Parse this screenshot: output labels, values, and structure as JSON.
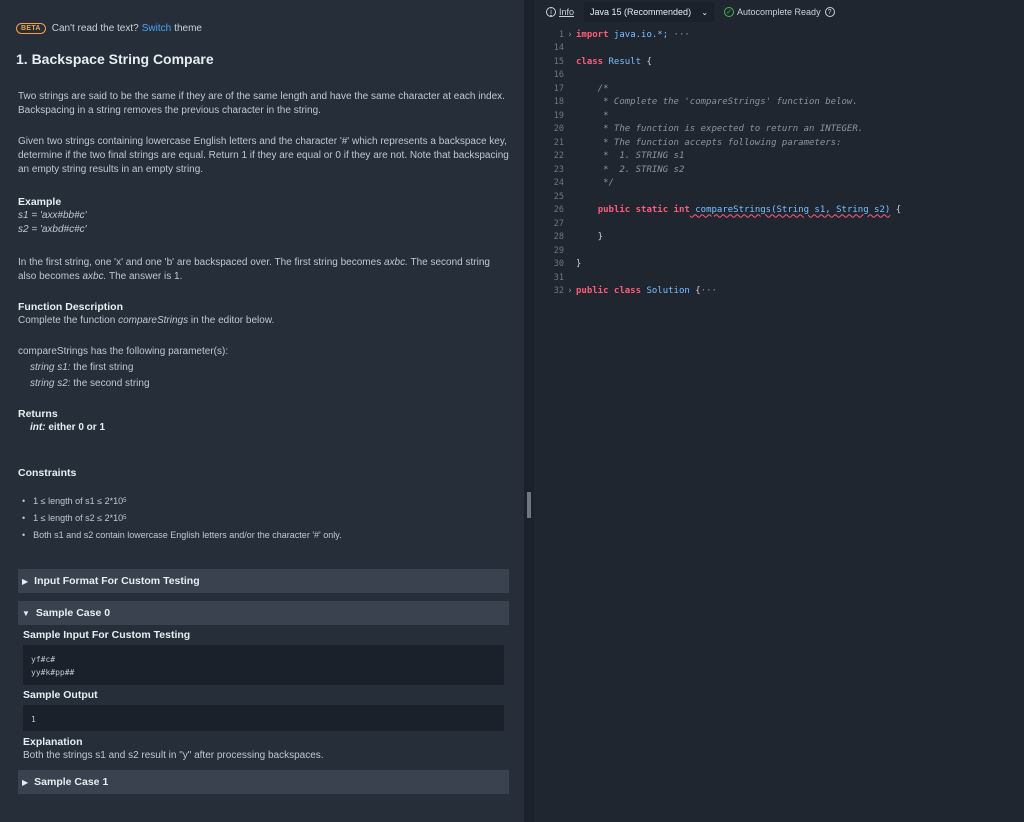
{
  "banner": {
    "badge": "BETA",
    "text_before": "Can't read the text?",
    "link": "Switch",
    "text_after": "theme"
  },
  "problem": {
    "title": "1. Backspace String Compare",
    "para1": "Two strings are said to be the same if they are of the same length and have the same character at each index. Backspacing in a string removes the previous character in the string.",
    "para2": "Given two strings containing lowercase English letters and the character '#' which represents a backspace key, determine if the two final strings are equal. Return 1 if they are equal or 0 if they are not. Note that backspacing an empty string results in an empty string.",
    "example_heading": "Example",
    "example_s1": "s1 = 'axx#bb#c'",
    "example_s2": "s2 = 'axbd#c#c'",
    "para3_a": "In the first string, one 'x' and one 'b' are backspaced over. The first string becomes ",
    "para3_em": "axbc.",
    "para3_b": " The second string also becomes ",
    "para3_em2": "axbc.",
    "para3_c": " The answer is 1.",
    "func_heading": "Function Description",
    "func_text_a": "Complete the function ",
    "func_text_em": "compareStrings",
    "func_text_b": " in the editor below.",
    "params_intro": "compareStrings has the following parameter(s):",
    "param1_name": "string s1:",
    "param1_desc": " the first string",
    "param2_name": "string s2:",
    "param2_desc": " the second string",
    "returns_heading": "Returns",
    "returns_type": "int:",
    "returns_desc": " either 0 or 1",
    "constraints_heading": "Constraints",
    "constraint1_a": "1 ≤ length of s1 ≤ 2*10",
    "constraint1_sup": "5",
    "constraint2_a": "1 ≤ length of s2 ≤ 2*10",
    "constraint2_sup": "5",
    "constraint3": "Both s1 and s2 contain lowercase English letters and/or the character '#' only."
  },
  "sections": {
    "input_format": "Input Format For Custom Testing",
    "sample0": "Sample Case 0",
    "sample_input_label": "Sample Input For Custom Testing",
    "sample_input_line1": "yf#c#",
    "sample_input_line2": "yy#k#pp##",
    "sample_output_label": "Sample Output",
    "sample_output": "1",
    "explanation_label": "Explanation",
    "explanation": "Both the strings s1 and s2 result in \"y\" after processing backspaces.",
    "sample1": "Sample Case 1"
  },
  "toolbar": {
    "info": "Info",
    "language": "Java 15 (Recommended)",
    "autocomplete": "Autocomplete Ready"
  },
  "editor": {
    "ln": [
      "1",
      "14",
      "15",
      "16",
      "17",
      "18",
      "19",
      "20",
      "21",
      "22",
      "23",
      "24",
      "25",
      "26",
      "27",
      "28",
      "29",
      "30",
      "31",
      "32"
    ],
    "l1_kw": "import",
    "l1_rest": " java.io.*;",
    "l1_ell": "···",
    "l15_kw": "class",
    "l15_cls": " Result",
    "l15_rest": " {",
    "l17": "    /*",
    "l18": "     * Complete the 'compareStrings' function below.",
    "l19": "     *",
    "l20": "     * The function is expected to return an INTEGER.",
    "l21": "     * The function accepts following parameters:",
    "l22": "     *  1. STRING s1",
    "l23": "     *  2. STRING s2",
    "l24": "     */",
    "l26_indent": "    ",
    "l26_kw": "public static int",
    "l26_fn": " compareStrings(String s1, String s2)",
    "l26_rest": " {",
    "l28": "    }",
    "l30": "}",
    "l32_kw": "public class",
    "l32_cls": " Solution",
    "l32_rest": " {",
    "l32_ell": "···"
  }
}
